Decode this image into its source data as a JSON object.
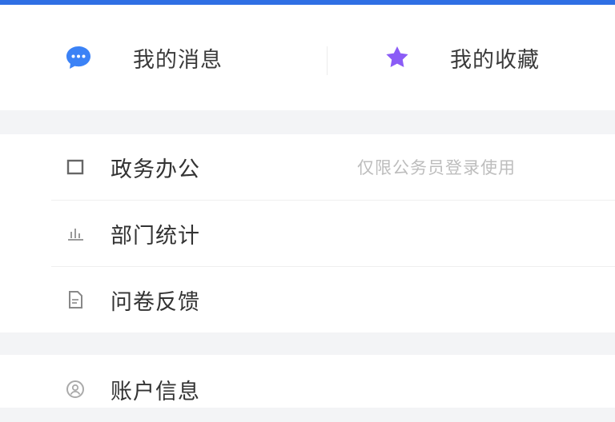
{
  "quick_actions": [
    {
      "label": "我的消息",
      "icon": "chat-bubble-icon",
      "color": "#3b82f6"
    },
    {
      "label": "我的收藏",
      "icon": "star-icon",
      "color": "#8b5cf6"
    }
  ],
  "menu_group_1": [
    {
      "label": "政务办公",
      "note": "仅限公务员登录使用",
      "icon": "square-icon"
    },
    {
      "label": "部门统计",
      "icon": "bar-chart-icon"
    },
    {
      "label": "问卷反馈",
      "icon": "document-icon"
    }
  ],
  "menu_group_2": [
    {
      "label": "账户信息",
      "icon": "account-circle-icon"
    }
  ],
  "colors": {
    "accent": "#2f6fe4",
    "page_bg": "#f3f4f6"
  }
}
